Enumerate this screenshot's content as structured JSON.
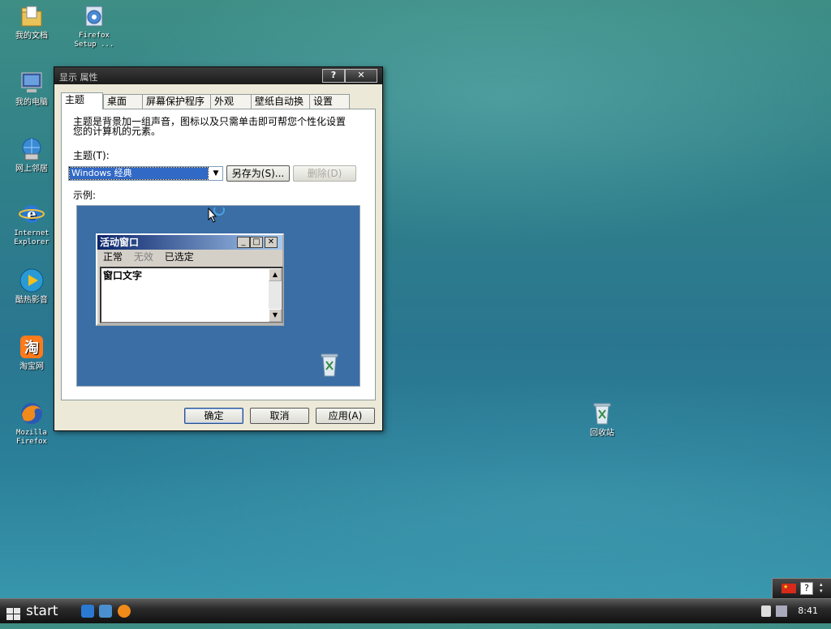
{
  "desktop": {
    "icons": [
      {
        "label": "我的文档"
      },
      {
        "label1": "Firefox",
        "label2": "Setup ..."
      },
      {
        "label": "我的电脑"
      },
      {
        "label": "网上邻居"
      },
      {
        "label1": "Internet",
        "label2": "Explorer"
      },
      {
        "label": "酷热影音"
      },
      {
        "label": "淘宝网"
      },
      {
        "label1": "Mozilla",
        "label2": "Firefox"
      },
      {
        "label": "回收站"
      }
    ]
  },
  "dialog": {
    "title": "显示 属性",
    "help_btn": "?",
    "close_btn": "✕",
    "tabs": [
      "主题",
      "桌面",
      "屏幕保护程序",
      "外观",
      "壁纸自动换",
      "设置"
    ],
    "description": [
      "主题是背景加一组声音，图标以及只需单击即可帮您个性化设置",
      "您的计算机的元素。"
    ],
    "theme_label": "主题(T):",
    "theme_value": "Windows 经典",
    "save_as_btn": "另存为(S)...",
    "delete_btn": "删除(D)",
    "sample_label": "示例:",
    "preview": {
      "window_title": "活动窗口",
      "menu": [
        "正常",
        "无效",
        "已选定"
      ],
      "text": "窗口文字"
    },
    "ok_btn": "确定",
    "cancel_btn": "取消",
    "apply_btn": "应用(A)"
  },
  "taskbar": {
    "start_label": "start",
    "clock": "8:41",
    "help_glyph": "?"
  },
  "colors": {
    "titlebar": "#1b1b1b",
    "preview_bg": "#3a6ea5",
    "selection": "#3169c6"
  }
}
